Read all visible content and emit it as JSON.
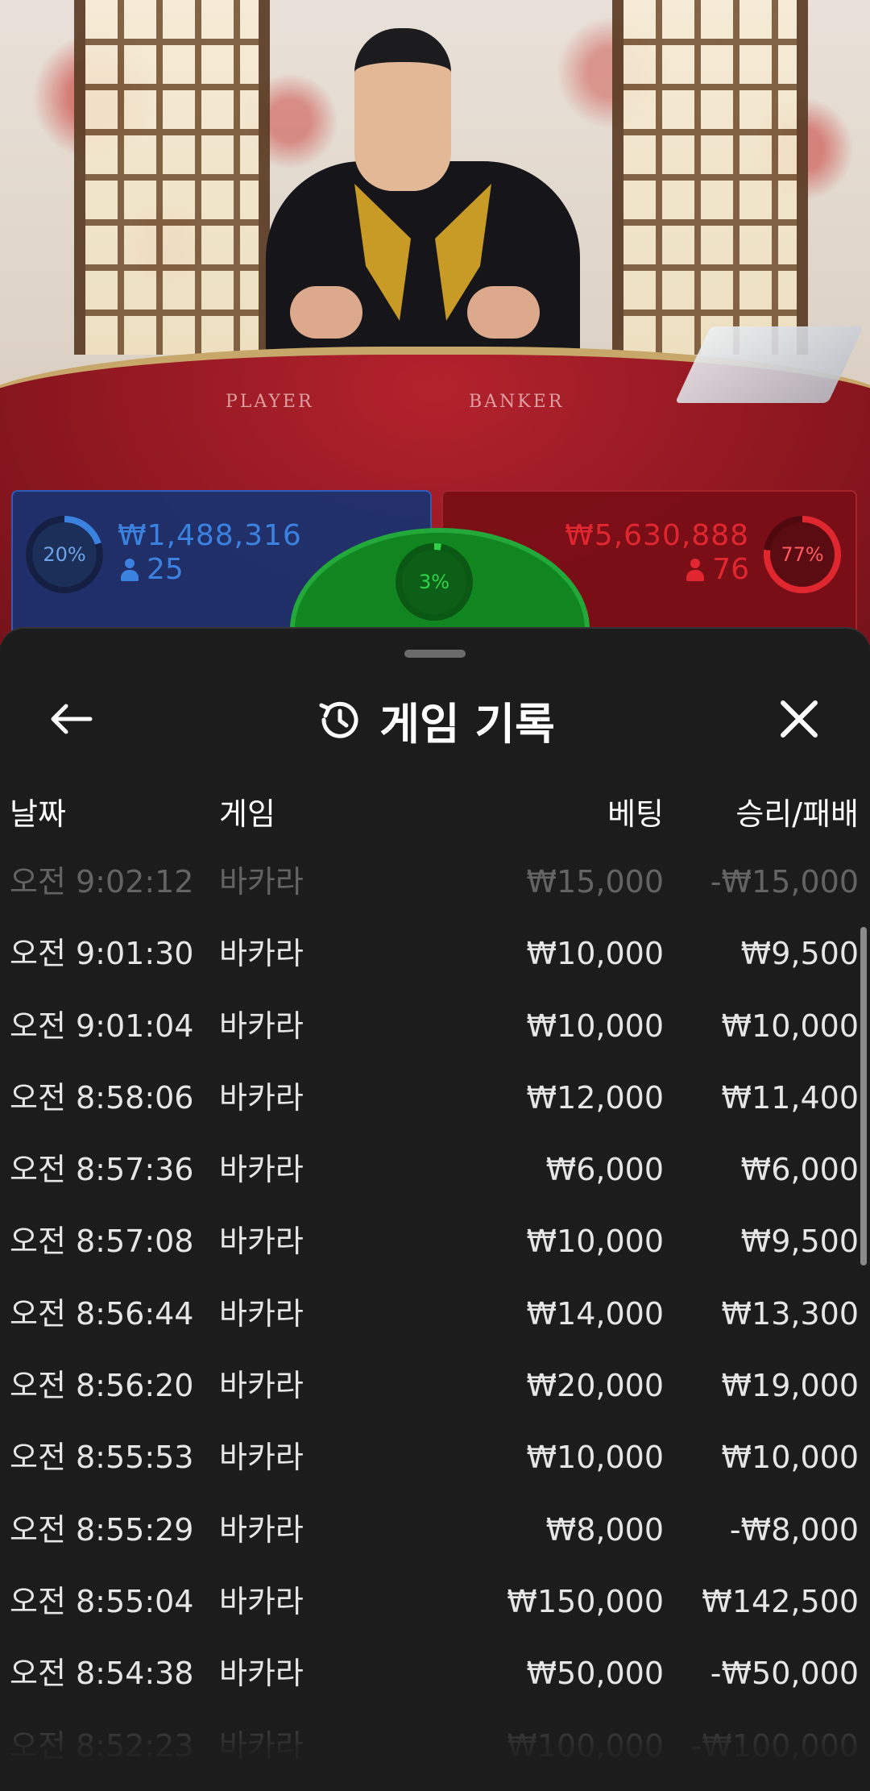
{
  "stats": {
    "player": {
      "percent_label": "20%",
      "percent": 20,
      "amount": "₩1,488,316",
      "players": "25",
      "color": "#3b82e0"
    },
    "tie": {
      "percent_label": "3%",
      "percent": 3,
      "color": "#2fd24a"
    },
    "banker": {
      "percent_label": "77%",
      "percent": 77,
      "amount": "₩5,630,888",
      "players": "76",
      "color": "#e0262f"
    }
  },
  "table": {
    "player_label": "PLAYER",
    "banker_label": "BANKER"
  },
  "sheet": {
    "title": "게임 기록",
    "back_icon": "arrow-left-icon",
    "history_icon": "history-icon",
    "close_icon": "close-icon"
  },
  "columns": {
    "date": "날짜",
    "game": "게임",
    "bet": "베팅",
    "result": "승리/패배"
  },
  "rows": [
    {
      "time": "오전 9:02:12",
      "game": "바카라",
      "bet": "₩15,000",
      "result": "-₩15,000"
    },
    {
      "time": "오전 9:01:30",
      "game": "바카라",
      "bet": "₩10,000",
      "result": "₩9,500"
    },
    {
      "time": "오전 9:01:04",
      "game": "바카라",
      "bet": "₩10,000",
      "result": "₩10,000"
    },
    {
      "time": "오전 8:58:06",
      "game": "바카라",
      "bet": "₩12,000",
      "result": "₩11,400"
    },
    {
      "time": "오전 8:57:36",
      "game": "바카라",
      "bet": "₩6,000",
      "result": "₩6,000"
    },
    {
      "time": "오전 8:57:08",
      "game": "바카라",
      "bet": "₩10,000",
      "result": "₩9,500"
    },
    {
      "time": "오전 8:56:44",
      "game": "바카라",
      "bet": "₩14,000",
      "result": "₩13,300"
    },
    {
      "time": "오전 8:56:20",
      "game": "바카라",
      "bet": "₩20,000",
      "result": "₩19,000"
    },
    {
      "time": "오전 8:55:53",
      "game": "바카라",
      "bet": "₩10,000",
      "result": "₩10,000"
    },
    {
      "time": "오전 8:55:29",
      "game": "바카라",
      "bet": "₩8,000",
      "result": "-₩8,000"
    },
    {
      "time": "오전 8:55:04",
      "game": "바카라",
      "bet": "₩150,000",
      "result": "₩142,500"
    },
    {
      "time": "오전 8:54:38",
      "game": "바카라",
      "bet": "₩50,000",
      "result": "-₩50,000"
    },
    {
      "time": "오전 8:52:23",
      "game": "바카라",
      "bet": "₩100,000",
      "result": "-₩100,000"
    }
  ]
}
